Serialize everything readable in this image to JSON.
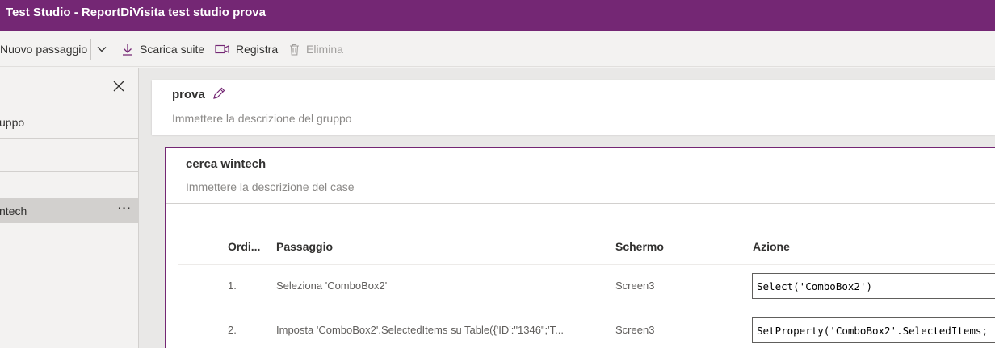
{
  "window": {
    "title": "Test Studio - ReportDiVisita test studio prova"
  },
  "toolbar": {
    "new_step": "Nuovo passaggio",
    "download_suite": "Scarica suite",
    "record": "Registra",
    "delete": "Elimina"
  },
  "sidebar": {
    "group_item": "uppo",
    "case_item": "ntech"
  },
  "group": {
    "name": "prova",
    "description_placeholder": "Immettere la descrizione del gruppo"
  },
  "test_case": {
    "name": "cerca wintech",
    "description_placeholder": "Immettere la descrizione del case"
  },
  "steps_table": {
    "columns": [
      "Ordi...",
      "Passaggio",
      "Schermo",
      "Azione"
    ],
    "rows": [
      {
        "order": "1.",
        "step": "Seleziona 'ComboBox2'",
        "screen": "Screen3",
        "action": "Select('ComboBox2')"
      },
      {
        "order": "2.",
        "step": "Imposta 'ComboBox2'.SelectedItems su Table({'ID':\"1346\";'T...",
        "screen": "Screen3",
        "action": "SetProperty('ComboBox2'.SelectedItems;"
      }
    ]
  },
  "colors": {
    "brand": "#742774",
    "background": "#f3f2f1"
  },
  "icons": [
    "chevron-down-icon",
    "download-icon",
    "record-icon",
    "trash-icon",
    "close-icon",
    "pencil-icon",
    "more-icon"
  ]
}
